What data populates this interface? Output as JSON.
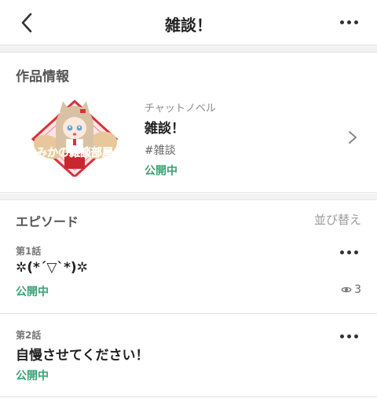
{
  "header": {
    "title": "雑談！",
    "back_icon": "chevron-left-icon",
    "more_icon": "more-horizontal-icon"
  },
  "work": {
    "section_title": "作品情報",
    "type": "チャットノベル",
    "title": "雑談！",
    "tag": "#雑談",
    "status": "公開中",
    "cover_text": "みかの雑談部屋"
  },
  "episodes": {
    "section_title": "エピソード",
    "sort_label": "並び替え",
    "items": [
      {
        "number": "第1話",
        "title": "✲(*´▽`*)✲",
        "status": "公開中",
        "views": "3"
      },
      {
        "number": "第2話",
        "title": "自慢させてください！",
        "status": "公開中"
      }
    ]
  },
  "colors": {
    "status_green": "#3aa273",
    "background_band": "#f2f2f2",
    "cover_orange": "#f2a23a",
    "cover_red": "#d8323c"
  }
}
